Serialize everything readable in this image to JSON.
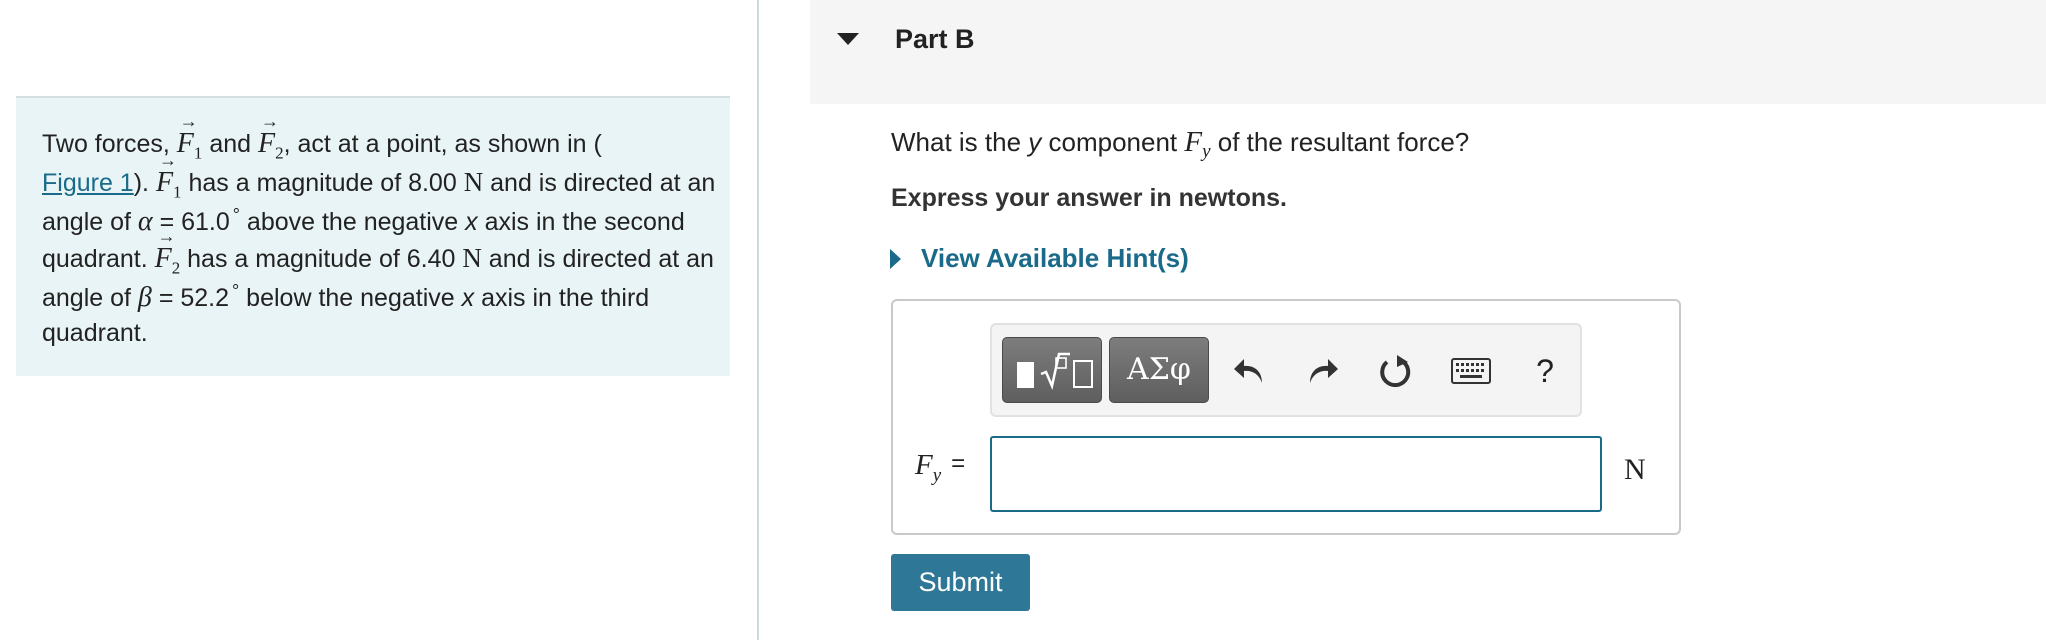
{
  "problem": {
    "t1": "Two forces, ",
    "f": "F",
    "s1": "1",
    "s2": "2",
    "t2": " and ",
    "t3": ", act at a point, as shown in (",
    "figure_link": "Figure 1",
    "t4": "). ",
    "t5": " has a magnitude of 8.00 ",
    "unitN": "N",
    "t6": " and is directed at an angle of ",
    "alpha": "α",
    "t7": " = 61.0",
    "deg": "°",
    "t8": " above the negative ",
    "x": "x",
    "t9": " axis in the second quadrant. ",
    "t10": " has a magnitude of 6.40 ",
    "t11": " and is directed at an angle of ",
    "beta": "β",
    "t12": " = 52.2",
    "t13": " below the negative ",
    "t14": " axis in the third quadrant."
  },
  "part": {
    "title": "Part B"
  },
  "question": {
    "q1": "What is the ",
    "y": "y",
    "q2": " component ",
    "F": "F",
    "sub": "y",
    "q3": " of the resultant force?",
    "instruction": "Express your answer in newtons."
  },
  "hint": {
    "label": "View Available Hint(s)"
  },
  "toolbar": {
    "greek_label": "ΑΣφ",
    "help_label": "?"
  },
  "answer": {
    "label_var": "F",
    "label_sub": "y",
    "label_eq": "=",
    "value": "",
    "unit": "N"
  },
  "submit": {
    "label": "Submit"
  },
  "colors": {
    "accent": "#1a6a8a",
    "submit_bg": "#2f7797",
    "problem_bg": "#e9f4f6"
  }
}
